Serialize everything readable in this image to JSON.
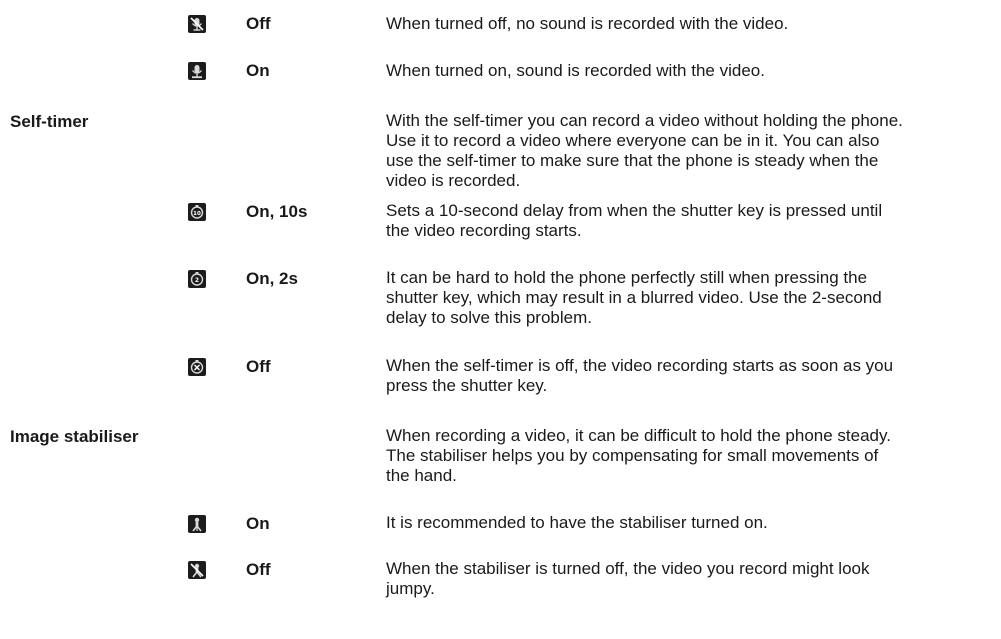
{
  "items": [
    {
      "icon": "microphone-off-icon",
      "label": "Off",
      "lines": [
        "When turned off, no sound is recorded with the video."
      ]
    },
    {
      "icon": "microphone-on-icon",
      "label": "On",
      "lines": [
        "When turned on, sound is recorded with the video."
      ]
    },
    {
      "heading": "Self-timer",
      "lines": [
        "With the self-timer you can record a video without holding the phone.",
        "Use it to record a video where everyone can be in it. You can also",
        "use the self-timer to make sure that the phone is steady when the",
        "video is recorded."
      ]
    },
    {
      "icon": "self-timer-10s-icon",
      "label": "On, 10s",
      "lines": [
        "Sets a 10-second delay from when the shutter key is pressed until",
        "the video recording starts."
      ]
    },
    {
      "icon": "self-timer-2s-icon",
      "label": "On, 2s",
      "lines": [
        "It can be hard to hold the phone perfectly still when pressing the",
        "shutter key, which may result in a blurred video. Use the 2-second",
        "delay to solve this problem."
      ]
    },
    {
      "icon": "self-timer-off-icon",
      "label": "Off",
      "lines": [
        "When the self-timer is off, the video recording starts as soon as you",
        "press the shutter key."
      ]
    },
    {
      "heading": "Image stabiliser",
      "lines": [
        "When recording a video, it can be difficult to hold the phone steady.",
        "The stabiliser helps you by compensating for small movements of",
        "the hand."
      ]
    },
    {
      "icon": "stabiliser-on-icon",
      "label": "On",
      "lines": [
        "It is recommended to have the stabiliser turned on."
      ]
    },
    {
      "icon": "stabiliser-off-icon",
      "label": "Off",
      "lines": [
        "When the stabiliser is turned off, the video you record might look",
        "jumpy."
      ]
    }
  ]
}
